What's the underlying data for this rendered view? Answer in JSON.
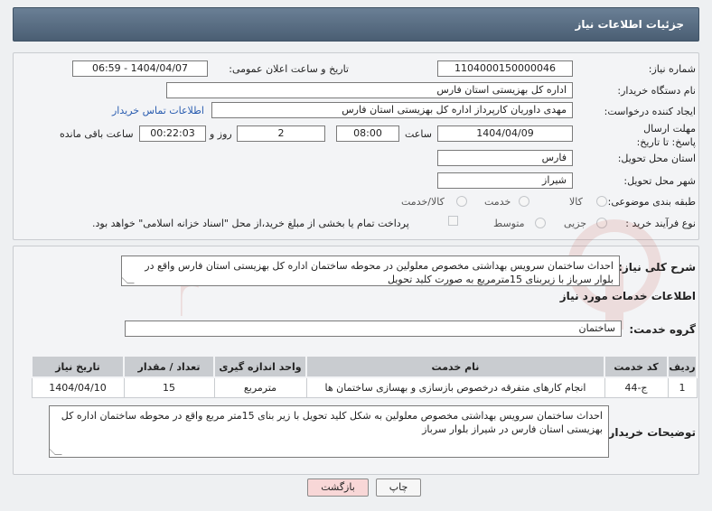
{
  "header": {
    "title": "جزئیات اطلاعات نیاز"
  },
  "form": {
    "need_number_label": "شماره نیاز:",
    "need_number": "1104000150000046",
    "announce_datetime_label": "تاریخ و ساعت اعلان عمومی:",
    "announce_datetime": "1404/04/07 - 06:59",
    "buyer_org_label": "نام دستگاه خریدار:",
    "buyer_org": "اداره کل بهزیستی استان فارس",
    "requester_label": "ایجاد کننده درخواست:",
    "requester": "مهدی داوریان کارپرداز اداره کل بهزیستی استان فارس",
    "buyer_contact_link": "اطلاعات تماس خریدار",
    "deadline_label": "مهلت ارسال پاسخ: تا تاریخ:",
    "deadline_date": "1404/04/09",
    "time_label": "ساعت",
    "deadline_time": "08:00",
    "days_value": "2",
    "days_label": "روز و",
    "remaining_time": "00:22:03",
    "remaining_label": "ساعت باقی مانده",
    "delivery_province_label": "استان محل تحویل:",
    "delivery_province": "فارس",
    "delivery_city_label": "شهر محل تحویل:",
    "delivery_city": "شیراز",
    "category_label": "طبقه بندی موضوعی:",
    "category_options": [
      "کالا",
      "خدمت",
      "کالا/خدمت"
    ],
    "purchase_type_label": "نوع فرآیند خرید :",
    "purchase_options": [
      "جزیی",
      "متوسط"
    ],
    "payment_note": "پرداخت تمام یا بخشی از مبلغ خرید،از محل \"اسناد خزانه اسلامی\" خواهد بود."
  },
  "summary": {
    "label": "شرح کلی نیاز:",
    "text": "احداث ساختمان  سرویس بهداشتی مخصوص معلولین در محوطه ساختمان اداره کل بهزیستی استان فارس واقع در بلوار سرباز با زیربنای 15مترمربع به صورت کلید تحویل"
  },
  "services": {
    "section_title": "اطلاعات خدمات مورد نیاز",
    "group_label": "گروه خدمت:",
    "group_value": "ساختمان",
    "columns": [
      "ردیف",
      "کد خدمت",
      "نام خدمت",
      "واحد اندازه گیری",
      "تعداد / مقدار",
      "تاریخ نیاز"
    ],
    "rows": [
      [
        "1",
        "ج-44",
        "انجام کارهای متفرقه درخصوص بازسازی و بهسازی ساختمان ها",
        "مترمربع",
        "15",
        "1404/04/10"
      ]
    ]
  },
  "buyer_notes": {
    "label": "توضیحات خریدار:",
    "text": "احداث ساختمان سرویس بهداشتی مخصوص معلولین به شکل کلید تحویل با زیر بنای 15متر مربع واقع در محوطه ساختمان اداره کل بهزیستی استان فارس در شیراز بلوار سرباز"
  },
  "actions": {
    "print_label": "چاپ",
    "back_label": "بازگشت"
  },
  "colors": {
    "header": "#4a5e73",
    "back_button": "#f8d7d7",
    "link": "#2a5db0"
  }
}
